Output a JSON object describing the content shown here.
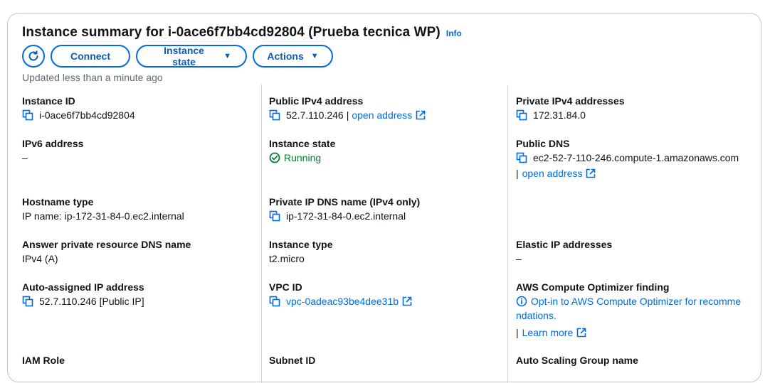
{
  "header": {
    "title": "Instance summary for i-0ace6f7bb4cd92804 (Prueba tecnica WP)",
    "info": "Info",
    "updated": "Updated less than a minute ago"
  },
  "actions": {
    "refresh_icon": "refresh-icon",
    "connect": "Connect",
    "instance_state": "Instance state",
    "actions": "Actions"
  },
  "col1": {
    "instance_id_label": "Instance ID",
    "instance_id": "i-0ace6f7bb4cd92804",
    "ipv6_label": "IPv6 address",
    "ipv6": "–",
    "hostname_type_label": "Hostname type",
    "hostname_type": "IP name: ip-172-31-84-0.ec2.internal",
    "answer_dns_label": "Answer private resource DNS name",
    "answer_dns": "IPv4 (A)",
    "auto_ip_label": "Auto-assigned IP address",
    "auto_ip": "52.7.110.246 [Public IP]",
    "iam_label": "IAM Role"
  },
  "col2": {
    "public_ipv4_label": "Public IPv4 address",
    "public_ipv4": "52.7.110.246",
    "open_address": "open address",
    "separator": "|",
    "state_label": "Instance state",
    "state": "Running",
    "private_dns_label": "Private IP DNS name (IPv4 only)",
    "private_dns": "ip-172-31-84-0.ec2.internal",
    "type_label": "Instance type",
    "type": "t2.micro",
    "vpc_label": "VPC ID",
    "vpc": "vpc-0adeac93be4dee31b",
    "subnet_label": "Subnet ID"
  },
  "col3": {
    "private_ipv4_label": "Private IPv4 addresses",
    "private_ipv4": "172.31.84.0",
    "public_dns_label": "Public DNS",
    "public_dns": "ec2-52-7-110-246.compute-1.amazonaws.com",
    "separator": "|",
    "open_address": "open address",
    "elastic_label": "Elastic IP addresses",
    "elastic": "–",
    "optimizer_label": "AWS Compute Optimizer finding",
    "optimizer_line1": "Opt-in to AWS Compute Optimizer for recomme",
    "optimizer_line2": "ndations.",
    "learn_more": "Learn more",
    "asg_label": "Auto Scaling Group name"
  },
  "colors": {
    "link": "#006ce0",
    "success": "#00802f",
    "border": "#c6c6cd"
  }
}
